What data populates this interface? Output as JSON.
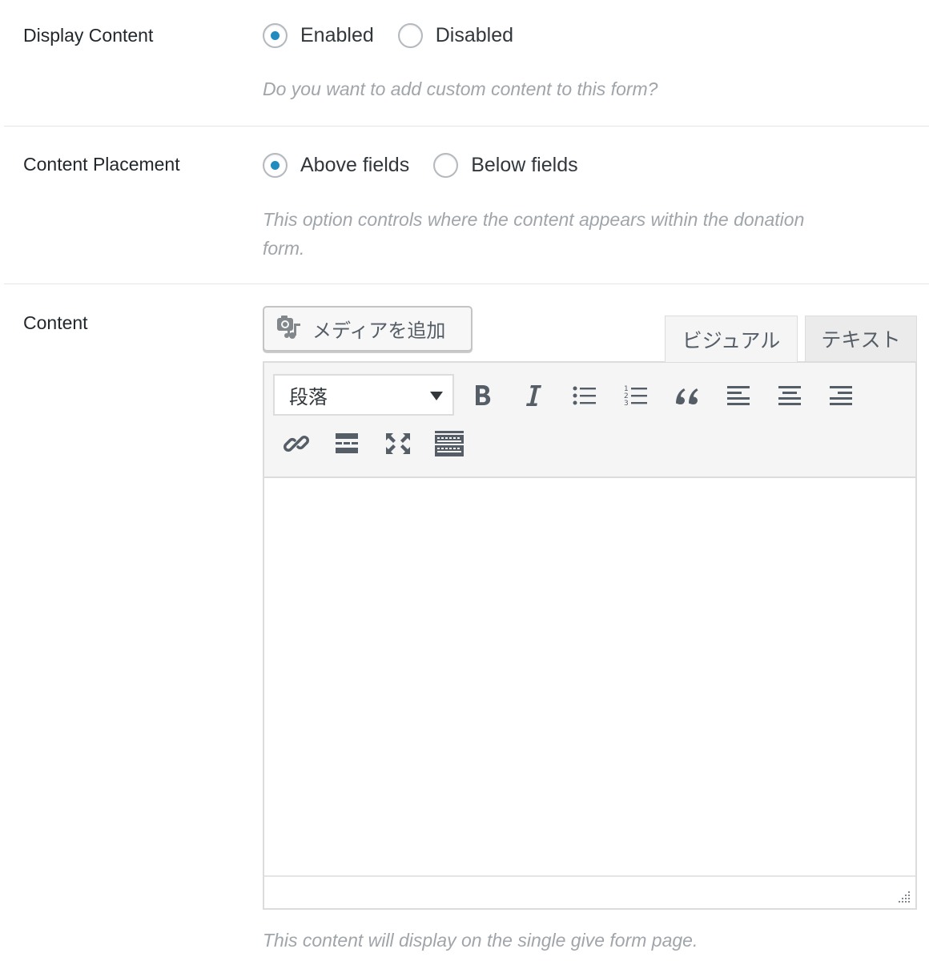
{
  "display_content": {
    "label": "Display Content",
    "options": [
      "Enabled",
      "Disabled"
    ],
    "selected": "Enabled",
    "description": "Do you want to add custom content to this form?"
  },
  "content_placement": {
    "label": "Content Placement",
    "options": [
      "Above fields",
      "Below fields"
    ],
    "selected": "Above fields",
    "description_line1": "This option controls where the content appears within the donation",
    "description_line2": "form."
  },
  "content": {
    "label": "Content",
    "media_button": "メディアを追加",
    "tabs": {
      "visual": "ビジュアル",
      "text": "テキスト"
    },
    "active_tab": "ビジュアル",
    "format_select": "段落",
    "toolbar_icons": [
      "bold-icon",
      "italic-icon",
      "bullet-list-icon",
      "numbered-list-icon",
      "blockquote-icon",
      "align-left-icon",
      "align-center-icon",
      "align-right-icon",
      "link-icon",
      "read-more-icon",
      "fullscreen-icon",
      "toolbar-toggle-icon"
    ],
    "body_text": "",
    "description": "This content will display on the single give form page."
  },
  "colors": {
    "accent": "#1e8cbe",
    "text": "#23282d",
    "muted": "#a0a5aa",
    "icon": "#555d66"
  }
}
